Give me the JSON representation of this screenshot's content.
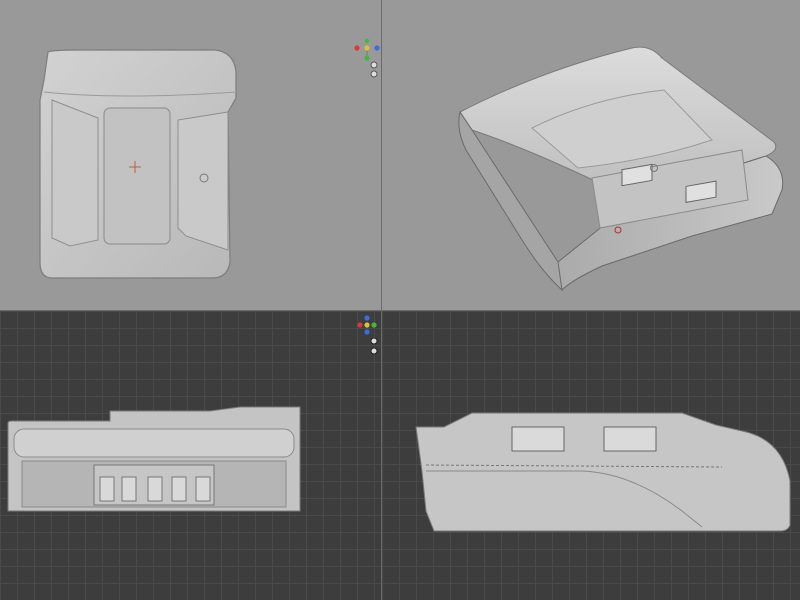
{
  "app": {
    "title": ""
  },
  "viewports": [
    {
      "id": "top-view",
      "style": "shaded",
      "background": "#999999"
    },
    {
      "id": "perspective-view",
      "style": "shaded",
      "background": "#999999"
    },
    {
      "id": "front-view",
      "style": "shaded-grid",
      "background": "#3d3d3d"
    },
    {
      "id": "side-view",
      "style": "shaded-grid",
      "background": "#3d3d3d"
    }
  ],
  "colors": {
    "model": "#c6c6c6",
    "model_shadow": "#8a8a8a",
    "grid_line": "#4a4a4a",
    "axis_x": "#d63b3b",
    "axis_y": "#44b444",
    "axis_z": "#3b6ed6",
    "gizmo_center": "#d6c23b"
  },
  "icons": [
    "view-gizmo-icon",
    "origin-cursor-icon",
    "usb-port-icon"
  ]
}
